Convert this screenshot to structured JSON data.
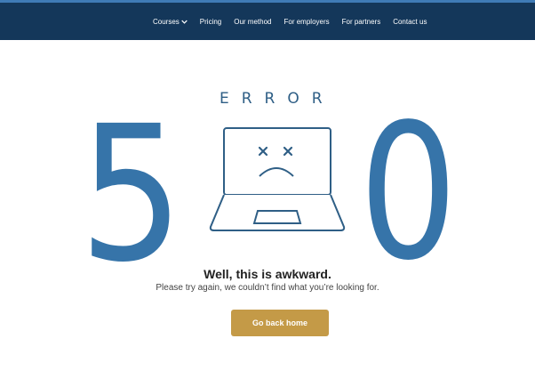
{
  "nav": {
    "items": [
      {
        "label": "Courses",
        "has_dropdown": true,
        "icon": "chevron-down-icon"
      },
      {
        "label": "Pricing"
      },
      {
        "label": "Our method"
      },
      {
        "label": "For employers"
      },
      {
        "label": "For partners"
      },
      {
        "label": "Contact us"
      }
    ]
  },
  "error": {
    "word": "ERROR",
    "digit_left": "5",
    "digit_right": "0",
    "illustration_icon": "sad-laptop-icon"
  },
  "message": {
    "headline": "Well, this is awkward.",
    "subline": "Please try again, we couldn’t find what you’re looking for."
  },
  "cta": {
    "label": "Go back home"
  },
  "colors": {
    "header_bg": "#14375a",
    "header_accent": "#3f7bb6",
    "digits": "#3674a9",
    "error_word": "#2f5f86",
    "button_bg": "#c49a47"
  }
}
